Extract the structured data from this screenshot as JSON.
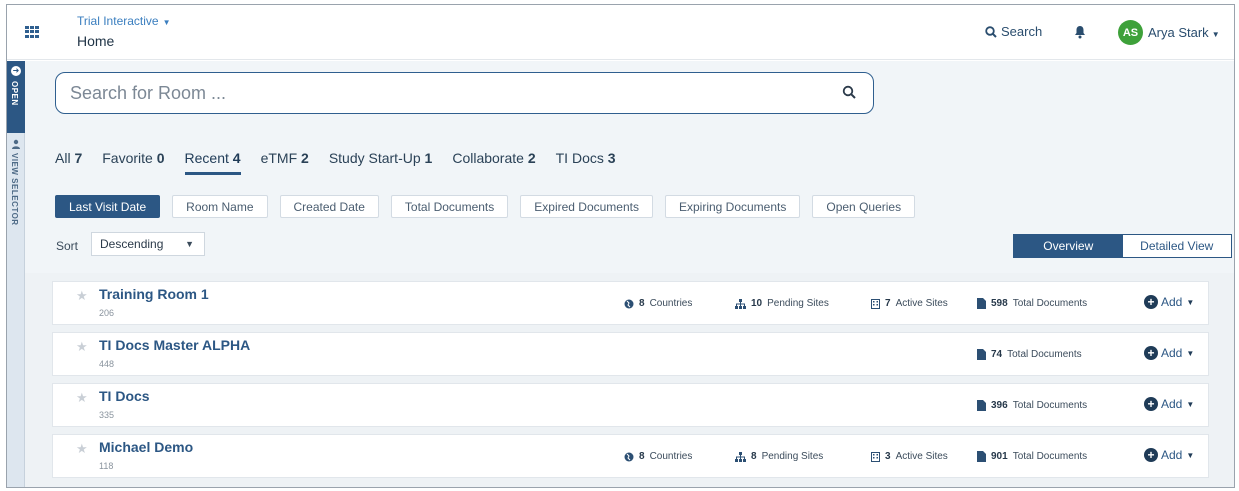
{
  "header": {
    "app_switcher_label": "Trial Interactive",
    "page_title": "Home",
    "search_label": "Search",
    "user_initials": "AS",
    "user_name": "Arya Stark",
    "avatar_color": "#3ea13a"
  },
  "side_tab": {
    "open_label": "OPEN",
    "selector_label": "VIEW SELECTOR"
  },
  "room_search": {
    "placeholder": "Search for Room ..."
  },
  "filter_tabs": [
    {
      "label": "All",
      "count": "7"
    },
    {
      "label": "Favorite",
      "count": "0"
    },
    {
      "label": "Recent",
      "count": "4",
      "active": true
    },
    {
      "label": "eTMF",
      "count": "2"
    },
    {
      "label": "Study Start-Up",
      "count": "1"
    },
    {
      "label": "Collaborate",
      "count": "2"
    },
    {
      "label": "TI Docs",
      "count": "3"
    }
  ],
  "sort_options": [
    "Last Visit Date",
    "Room Name",
    "Created Date",
    "Total Documents",
    "Expired Documents",
    "Expiring Documents",
    "Open Queries"
  ],
  "active_sort_option": "Last Visit Date",
  "sort": {
    "label": "Sort",
    "value": "Descending"
  },
  "view_toggle": {
    "overview": "Overview",
    "detailed": "Detailed View",
    "active": "Overview"
  },
  "stat_labels": {
    "countries": "Countries",
    "pending_sites": "Pending Sites",
    "active_sites": "Active Sites",
    "total_documents": "Total Documents",
    "add": "Add"
  },
  "rooms": [
    {
      "name": "Training Room 1",
      "id": "206",
      "countries": "8",
      "pending_sites": "10",
      "active_sites": "7",
      "total_documents": "598"
    },
    {
      "name": "TI Docs Master ALPHA",
      "id": "448",
      "total_documents": "74"
    },
    {
      "name": "TI Docs",
      "id": "335",
      "total_documents": "396"
    },
    {
      "name": "Michael Demo",
      "id": "118",
      "countries": "8",
      "pending_sites": "8",
      "active_sites": "3",
      "total_documents": "901"
    }
  ],
  "colors": {
    "primary": "#2c5784",
    "link": "#3a7ebf",
    "panel_bg": "#f1f5f8"
  }
}
